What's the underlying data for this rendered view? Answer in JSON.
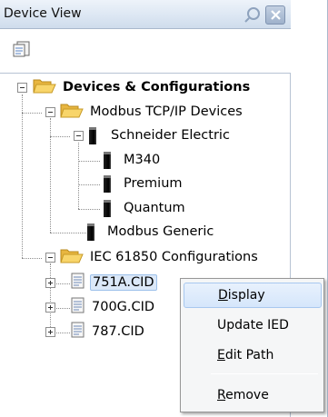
{
  "panel": {
    "title": "Device View"
  },
  "tree": {
    "root": {
      "label": "Devices & Configurations"
    },
    "modbus": {
      "label": "Modbus TCP/IP Devices"
    },
    "schneider": {
      "label": "Schneider Electric"
    },
    "m340": {
      "label": "M340"
    },
    "premium": {
      "label": "Premium"
    },
    "quantum": {
      "label": "Quantum"
    },
    "modbus_generic": {
      "label": "Modbus Generic"
    },
    "iec": {
      "label": "IEC 61850 Configurations"
    },
    "cid_files": [
      {
        "label": "751A.CID"
      },
      {
        "label": "700G.CID"
      },
      {
        "label": "787.CID"
      }
    ]
  },
  "context_menu": {
    "display": {
      "pre": "",
      "ul": "D",
      "post": "isplay"
    },
    "update": {
      "label": "Update IED"
    },
    "edit": {
      "pre": "",
      "ul": "E",
      "post": "dit Path"
    },
    "remove": {
      "pre": "",
      "ul": "R",
      "post": "emove"
    }
  }
}
